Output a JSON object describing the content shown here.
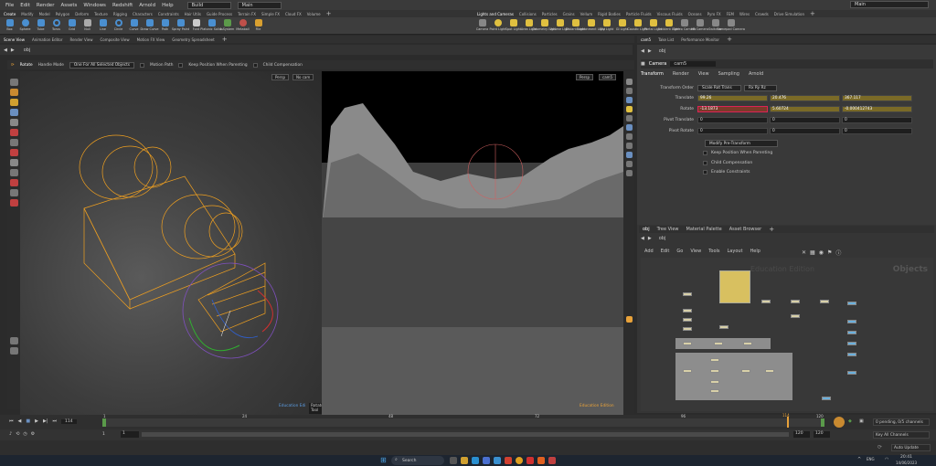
{
  "menubar": {
    "items": [
      "File",
      "Edit",
      "Render",
      "Assets",
      "Windows",
      "Redshift",
      "Arnold",
      "Help"
    ],
    "build": "Build",
    "desktop": "Main",
    "main": "Main"
  },
  "shelf_tabs_left": [
    "Create",
    "Modify",
    "Model",
    "Polygon",
    "Deform",
    "Texture",
    "Rigging",
    "Characters",
    "Constraints",
    "Hair Utils",
    "Guide Process",
    "Terrain FX",
    "Simple FX",
    "Cloud FX",
    "Volume"
  ],
  "shelf_tabs_right": [
    "Lights and Cameras",
    "Collisions",
    "Particles",
    "Grains",
    "Vellum",
    "Rigid Bodies",
    "Particle Fluids",
    "Viscous Fluids",
    "Oceans",
    "Pyro FX",
    "FEM",
    "Wires",
    "Crowds",
    "Drive Simulation"
  ],
  "shelf_tools_left": [
    "Box",
    "Sphere",
    "Tube",
    "Torus",
    "Grid",
    "Null",
    "Line",
    "Circle",
    "Curve",
    "Draw Curve",
    "Path",
    "Spray Paint",
    "Font",
    "Platonic Solids",
    "L-System",
    "Metaball",
    "File"
  ],
  "shelf_tools_right": [
    "Camera",
    "Point Light",
    "Spot Light",
    "Area Light",
    "Geometry Light",
    "Volume Light",
    "Distant Light",
    "Environment Light",
    "Sky Light",
    "GI Light",
    "Caustic Light",
    "Portal Light",
    "Ambient Light",
    "Stereo Camera",
    "VR Camera",
    "Switcher",
    "Gamepad Camera"
  ],
  "pane_tabs_left": [
    "Scene View",
    "Animation Editor",
    "Render View",
    "Composite View",
    "Motion FX View",
    "Geometry Spreadsheet"
  ],
  "pane_tabs_right": [
    "cam5",
    "Take List",
    "Performance Monitor"
  ],
  "path": "obj",
  "opbar": {
    "tool": "Rotate",
    "handle_mode": "Handle Mode",
    "selection": "One For All Selected Objects",
    "motion_path": "Motion Path",
    "keep_position": "Keep Position When Parenting",
    "child_comp": "Child Compensation"
  },
  "vp_left": {
    "persp": "Persp",
    "cam": "No cam",
    "edu": "Education Edi",
    "rotate_tool": "Rotate Tool"
  },
  "vp_right": {
    "persp": "Persp",
    "cam": "cam5",
    "edu": "Education Edition"
  },
  "params": {
    "type": "Camera",
    "name": "cam5",
    "tabs": [
      "Transform",
      "Render",
      "View",
      "Sampling",
      "Arnold"
    ],
    "transform_order_label": "Transform Order",
    "transform_order": "Scale Rot Trans",
    "rot_order": "Rx Ry Rz",
    "translate_label": "Translate",
    "translate": [
      "99.26",
      "20.476",
      "367.117"
    ],
    "rotate_label": "Rotate",
    "rotate": [
      "-13.1873",
      "5.60724",
      "-0.000412743"
    ],
    "pivot_t_label": "Pivot Translate",
    "pivot_t": [
      "0",
      "0",
      "0"
    ],
    "pivot_r_label": "Pivot Rotate",
    "pivot_r": [
      "0",
      "0",
      "0"
    ],
    "modify_btn": "Modify Pre-Transform",
    "cb1": "Keep Position When Parenting",
    "cb2": "Child Compensation",
    "cb3": "Enable Constraints"
  },
  "net_tabs": [
    "obj",
    "Tree View",
    "Material Palette",
    "Asset Browser"
  ],
  "net_menu": [
    "Add",
    "Edit",
    "Go",
    "View",
    "Tools",
    "Layout",
    "Help"
  ],
  "net_path": "obj",
  "net_watermark": "Education Edition",
  "net_objects": "Objects",
  "timeline": {
    "frame": "114",
    "ticks": [
      "1",
      "24",
      "48",
      "72",
      "96",
      "120"
    ],
    "start": "1",
    "start2": "1",
    "end": "120",
    "end2": "120",
    "pending": "0 pending, 0/5 channels",
    "keys": "Key All Channels",
    "auto_update": "Auto Update"
  },
  "taskbar": {
    "search": "Search",
    "lang": "ENG",
    "time": "20:41",
    "date": "14/06/2023"
  },
  "colors": {
    "accent": "#e8a23a",
    "camera_wire": "#f0a020",
    "key_yellow": "#7a6a27"
  }
}
